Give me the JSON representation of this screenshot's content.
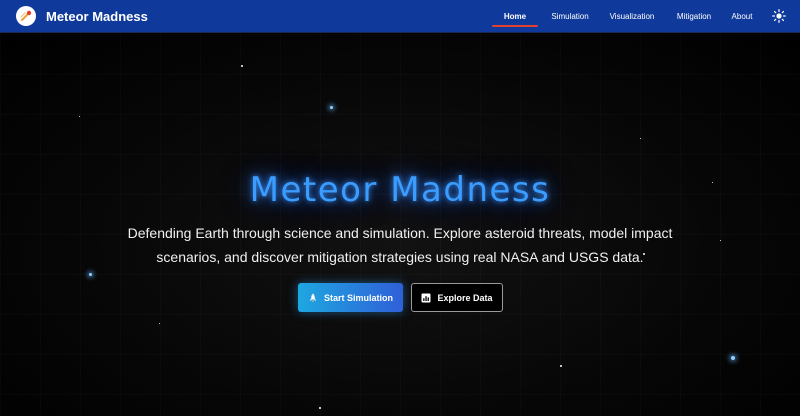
{
  "app": {
    "title": "Meteor Madness",
    "brand_color": "#0f3a9c"
  },
  "nav": {
    "items": [
      {
        "label": "Home",
        "active": true
      },
      {
        "label": "Simulation",
        "active": false
      },
      {
        "label": "Visualization",
        "active": false
      },
      {
        "label": "Mitigation",
        "active": false
      },
      {
        "label": "About",
        "active": false
      }
    ],
    "active_indicator_color": "#e2402f",
    "theme_toggle_icon": "sun-icon"
  },
  "hero": {
    "title": "Meteor Madness",
    "title_color": "#3b9cff",
    "subtitle": "Defending Earth through science and simulation. Explore asteroid threats, model impact scenarios, and discover mitigation strategies using real NASA and USGS data.",
    "primary_button": {
      "label": "Start Simulation",
      "icon": "rocket-icon"
    },
    "secondary_button": {
      "label": "Explore Data",
      "icon": "chart-icon"
    }
  }
}
